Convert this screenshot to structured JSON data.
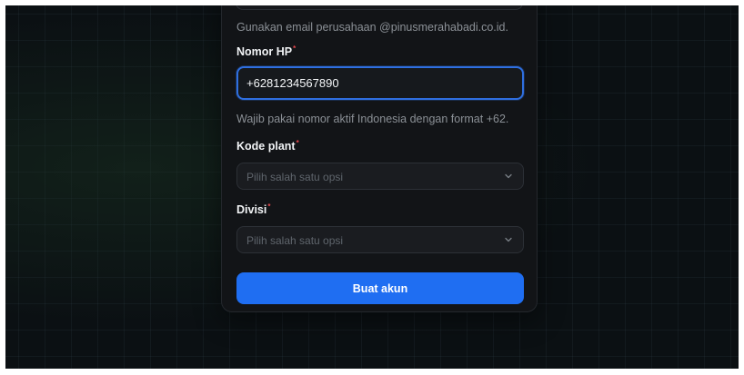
{
  "form": {
    "email_hint": "Gunakan email perusahaan @pinusmerahabadi.co.id.",
    "phone": {
      "label": "Nomor HP",
      "required_mark": "*",
      "value": "+6281234567890",
      "hint": "Wajib pakai nomor aktif Indonesia dengan format +62."
    },
    "plant": {
      "label": "Kode plant",
      "required_mark": "*",
      "placeholder": "Pilih salah satu opsi"
    },
    "division": {
      "label": "Divisi",
      "required_mark": "*",
      "placeholder": "Pilih salah satu opsi"
    },
    "submit_label": "Buat akun"
  },
  "colors": {
    "accent": "#1f6ef2",
    "focus_border": "#2f6fe0",
    "required": "#e5484d",
    "page_background": "#0b1013",
    "card_background": "#121417"
  },
  "icons": {
    "select_chevron": "chevron-down-icon"
  }
}
